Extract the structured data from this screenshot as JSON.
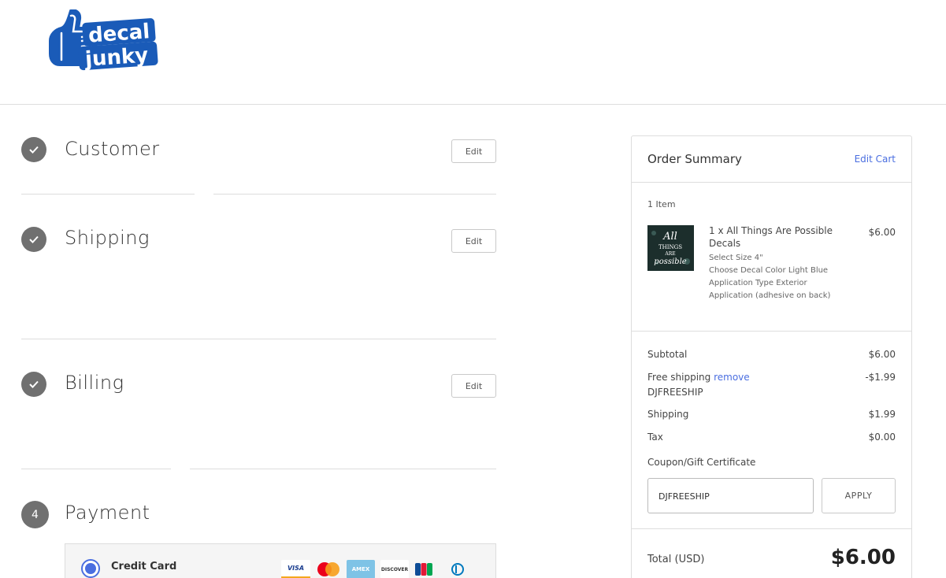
{
  "brand": {
    "logo_line1": "decal",
    "logo_line2": "junky"
  },
  "steps": [
    {
      "number": "",
      "title": "Customer",
      "status": "complete",
      "edit_label": "Edit"
    },
    {
      "number": "",
      "title": "Shipping",
      "status": "complete",
      "edit_label": "Edit"
    },
    {
      "number": "",
      "title": "Billing",
      "status": "complete",
      "edit_label": "Edit"
    },
    {
      "number": "4",
      "title": "Payment",
      "status": "active",
      "edit_label": ""
    }
  ],
  "payment": {
    "method_label": "Credit Card",
    "selected": true,
    "cards": [
      "VISA",
      "mastercard",
      "AMEX",
      "DISCOVER",
      "JCB",
      "diners"
    ]
  },
  "summary": {
    "title": "Order Summary",
    "edit_cart": "Edit Cart",
    "item_count": "1 Item",
    "item": {
      "thumb_text": [
        "All",
        "THINGS",
        "ARE",
        "possible"
      ],
      "name": "1 x All Things Are Possible Decals",
      "options": [
        "Select Size 4\"",
        "Choose Decal Color Light Blue",
        "Application Type Exterior Application (adhesive on back)"
      ],
      "price": "$6.00"
    },
    "subtotal_label": "Subtotal",
    "subtotal_value": "$6.00",
    "discount_label": "Free shipping",
    "discount_remove": "remove",
    "discount_code": "DJFREESHIP",
    "discount_value": "-$1.99",
    "shipping_label": "Shipping",
    "shipping_value": "$1.99",
    "tax_label": "Tax",
    "tax_value": "$0.00",
    "coupon_label": "Coupon/Gift Certificate",
    "coupon_value": "DJFREESHIP",
    "apply_label": "APPLY",
    "total_label": "Total (USD)",
    "total_value": "$6.00"
  },
  "colors": {
    "accent": "#4a6ee0",
    "brand": "#1a5bb8",
    "step_icon": "#707070"
  }
}
